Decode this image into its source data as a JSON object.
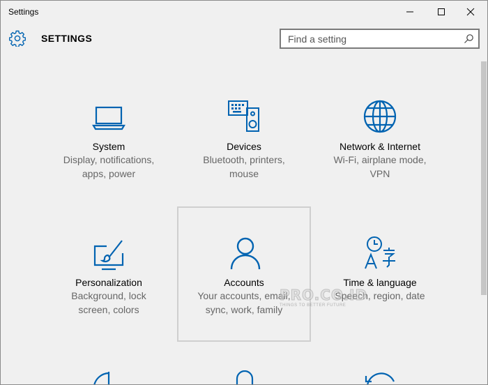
{
  "window": {
    "title": "Settings",
    "controls": [
      "minimize-icon",
      "maximize-icon",
      "close-icon"
    ]
  },
  "header": {
    "icon": "gear-icon",
    "title": "SETTINGS"
  },
  "search": {
    "placeholder": "Find a setting",
    "value": "",
    "icon": "search-icon"
  },
  "colors": {
    "accent": "#0063b1",
    "background": "#f0f0f0",
    "description_text": "#666666"
  },
  "tiles": [
    {
      "name": "System",
      "desc1": "Display, notifications,",
      "desc2": "apps, power",
      "icon": "laptop-icon"
    },
    {
      "name": "Devices",
      "desc1": "Bluetooth, printers,",
      "desc2": "mouse",
      "icon": "keyboard-speaker-icon"
    },
    {
      "name": "Network & Internet",
      "desc1": "Wi-Fi, airplane mode,",
      "desc2": "VPN",
      "icon": "globe-icon"
    },
    {
      "name": "Personalization",
      "desc1": "Background, lock",
      "desc2": "screen, colors",
      "icon": "paintbrush-monitor-icon"
    },
    {
      "name": "Accounts",
      "desc1": "Your accounts, email,",
      "desc2": "sync, work, family",
      "icon": "person-icon",
      "selected": true
    },
    {
      "name": "Time & language",
      "desc1": "Speech, region, date",
      "desc2": "",
      "icon": "time-language-icon"
    }
  ],
  "watermark": {
    "text": "PRO.CO.ID",
    "subtext": "THINGS TO BETTER FUTURE"
  }
}
